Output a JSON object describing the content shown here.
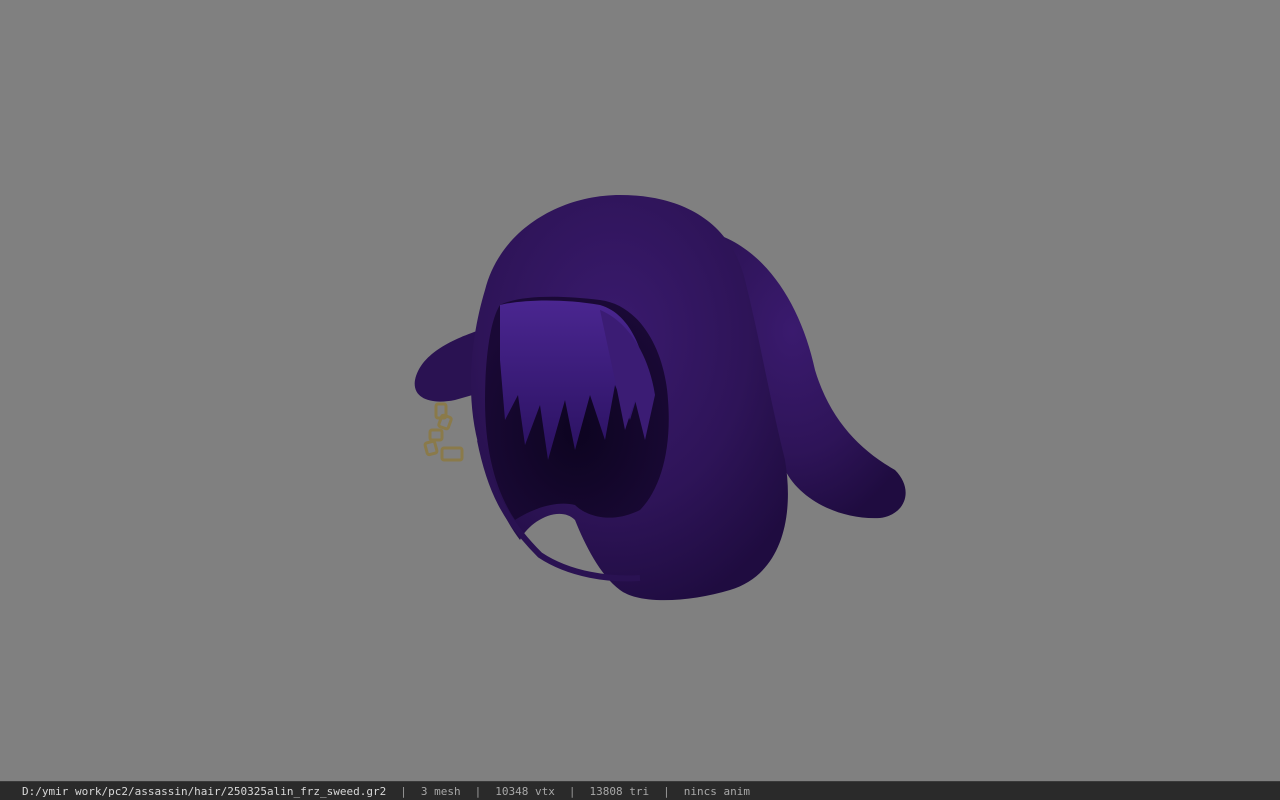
{
  "viewer": {
    "background_color": "#808080",
    "model": {
      "description_icon": "hooded-hair-model",
      "hood_color": "#2e1458",
      "hair_color": "#3d1d78",
      "chain_color": "#8a7a4a"
    }
  },
  "status_bar": {
    "file_path": "D:/ymir work/pc2/assassin/hair/250325alin_frz_sweed.gr2",
    "separator": "|",
    "mesh_count": "3 mesh",
    "vertex_count": "10348 vtx",
    "triangle_count": "13808 tri",
    "anim_text": "nincs anim"
  }
}
